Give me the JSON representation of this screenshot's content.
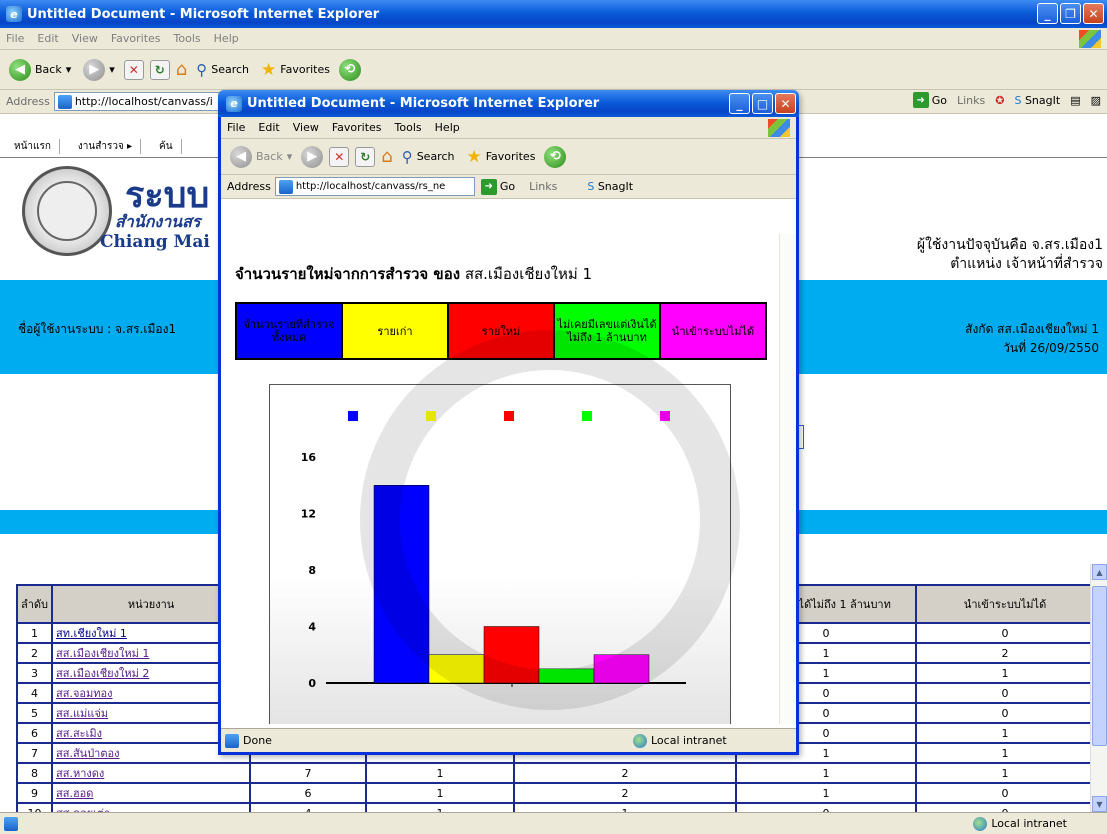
{
  "main_window": {
    "title": "Untitled Document - Microsoft Internet Explorer",
    "menu": [
      "File",
      "Edit",
      "View",
      "Favorites",
      "Tools",
      "Help"
    ],
    "toolbar": {
      "back": "Back",
      "search": "Search",
      "favorites": "Favorites"
    },
    "address_label": "Address",
    "address_value": "http://localhost/canvass/i",
    "go_label": "Go",
    "links_label": "Links",
    "snagit_label": "SnagIt",
    "status_zone": "Local intranet"
  },
  "page": {
    "nav": [
      "หน้าแรก",
      "งานสำรวจ ▸",
      "ค้น"
    ],
    "site_title": "ระบบ",
    "site_sub": "สำนักงานสร",
    "site_sub2": "Chiang Mai",
    "user_line1": "ผู้ใช้งานปัจจุบันคือ จ.สร.เมือง1",
    "user_line2": "ตำแหน่ง เจ้าหน้าที่สำรวจ",
    "band_user": "ชื่อผู้ใช้งานระบบ : จ.สร.เมือง1",
    "band_affil": "สังกัด สส.เมืองเชียงใหม่ 1",
    "band_date": "วันที่ 26/09/2550"
  },
  "table": {
    "headers": [
      "ลำดับ",
      "หน่วยงาน",
      "",
      "",
      "",
      "ยแต่เงินได้ไม่ถึง 1 ล้านบาท",
      "นำเข้าระบบไม่ได้"
    ],
    "rows": [
      [
        "1",
        "สท.เชียงใหม่ 1",
        "",
        "",
        "",
        "0",
        "0"
      ],
      [
        "2",
        "สส.เมืองเชียงใหม่ 1",
        "",
        "",
        "",
        "1",
        "2"
      ],
      [
        "3",
        "สส.เมืองเชียงใหม่ 2",
        "",
        "",
        "",
        "1",
        "1"
      ],
      [
        "4",
        "สส.จอมทอง",
        "",
        "",
        "",
        "0",
        "0"
      ],
      [
        "5",
        "สส.แม่แจ่ม",
        "",
        "",
        "",
        "0",
        "0"
      ],
      [
        "6",
        "สส.สะเมิง",
        "",
        "",
        "",
        "0",
        "1"
      ],
      [
        "7",
        "สส.สันป่าตอง",
        "",
        "",
        "",
        "1",
        "1"
      ],
      [
        "8",
        "สส.หางดง",
        "7",
        "1",
        "2",
        "1",
        "1"
      ],
      [
        "9",
        "สส.ฮอด",
        "6",
        "1",
        "2",
        "1",
        "0"
      ],
      [
        "10",
        "สส.ดอยเต่า",
        "4",
        "1",
        "1",
        "0",
        "0"
      ]
    ]
  },
  "popup": {
    "title": "Untitled Document - Microsoft Internet Explorer",
    "menu": [
      "File",
      "Edit",
      "View",
      "Favorites",
      "Tools",
      "Help"
    ],
    "toolbar": {
      "back": "Back",
      "search": "Search",
      "favorites": "Favorites"
    },
    "address_label": "Address",
    "address_value": "http://localhost/canvass/rs_ne",
    "go_label": "Go",
    "links_label": "Links",
    "snagit_label": "SnagIt",
    "status_done": "Done",
    "status_zone": "Local intranet",
    "heading_bold": "จำนวนรายใหม่จากการสำรวจ ของ",
    "heading_unit": "สส.เมืองเชียงใหม่ 1",
    "legend": [
      {
        "label": "จำนวนรายที่สำรวจทั้งหมด",
        "color": "#0000ff"
      },
      {
        "label": "รายเก่า",
        "color": "#ffff00"
      },
      {
        "label": "รายใหม่",
        "color": "#ff0000"
      },
      {
        "label": "ไม่เคยมีเลขแต่เงินได้ไม่ถึง 1 ล้านบาท",
        "color": "#00ff00"
      },
      {
        "label": "นำเข้าระบบไม่ได้",
        "color": "#ff00ff"
      }
    ]
  },
  "chart_data": {
    "type": "bar",
    "categories": [
      "จำนวนรายที่สำรวจทั้งหมด",
      "รายเก่า",
      "รายใหม่",
      "ไม่เคยมีเลขแต่เงินได้ไม่ถึง 1 ล้านบาท",
      "นำเข้าระบบไม่ได้"
    ],
    "values": [
      14,
      2,
      4,
      1,
      2
    ],
    "colors": [
      "#0000ff",
      "#ffff00",
      "#ff0000",
      "#00ff00",
      "#ff00ff"
    ],
    "yticks": [
      "0",
      "4",
      "8",
      "12",
      "16"
    ],
    "ylim": [
      0,
      16
    ],
    "title": "",
    "xlabel": "",
    "ylabel": "",
    "grid": false,
    "legend_position": "top"
  }
}
